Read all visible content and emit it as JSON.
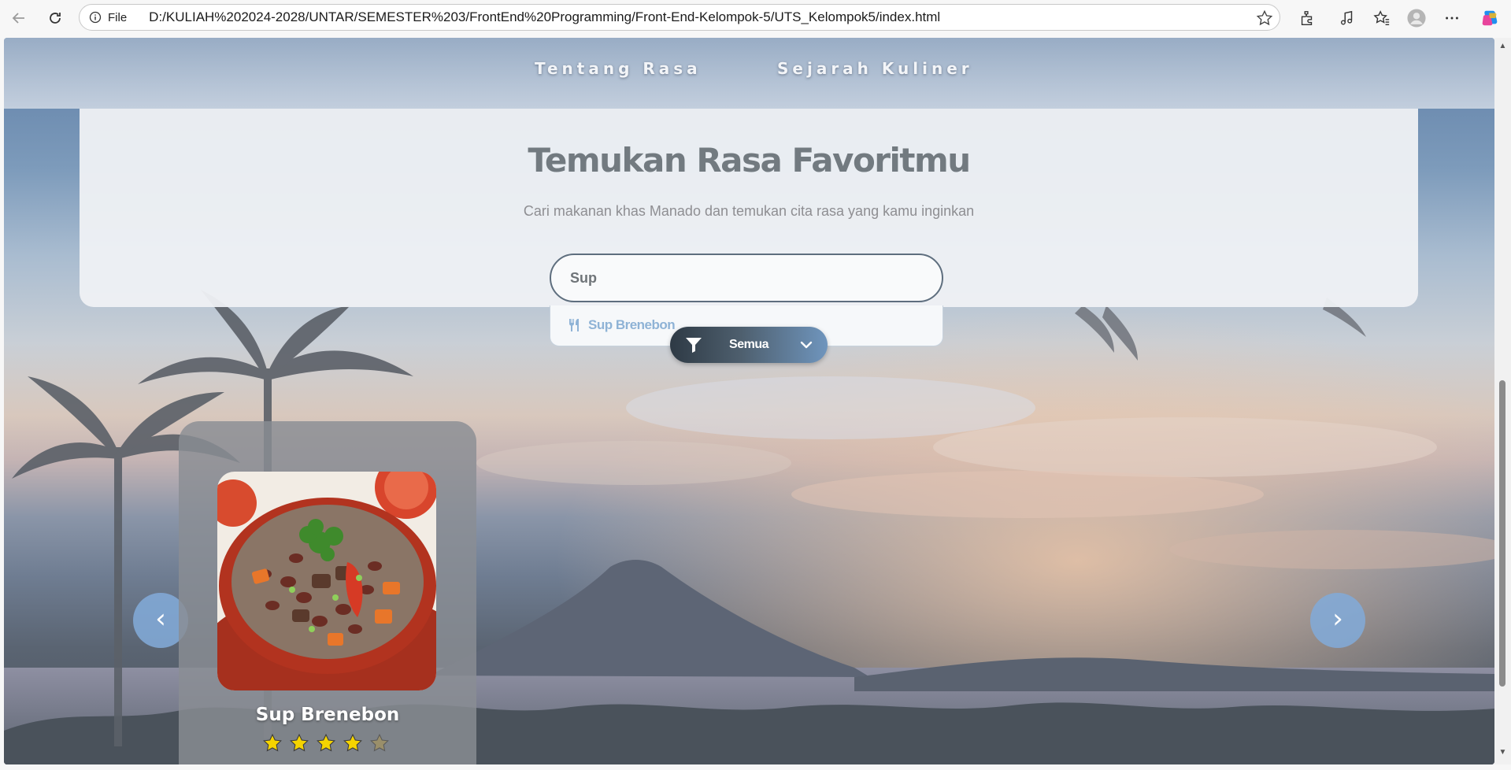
{
  "browser": {
    "file_label": "File",
    "url": "D:/KULIAH%202024-2028/UNTAR/SEMESTER%203/FrontEnd%20Programming/Front-End-Kelompok-5/UTS_Kelompok5/index.html"
  },
  "nav": {
    "links": [
      "Tentang Rasa",
      "Sejarah Kuliner"
    ]
  },
  "search": {
    "title": "Temukan Rasa Favoritmu",
    "subtitle": "Cari makanan khas Manado dan temukan cita rasa yang kamu inginkan",
    "query": "Sup",
    "suggestions": [
      {
        "label": "Sup Brenebon",
        "icon": "fork-knife-icon"
      }
    ]
  },
  "filter": {
    "label": "Semua",
    "icon": "filter-icon"
  },
  "carousel": {
    "prev_label": "‹",
    "next_label": "›",
    "cards": [
      {
        "name": "Sup Brenebon",
        "rating": 4,
        "max_rating": 5
      }
    ]
  },
  "colors": {
    "accent": "#8fb3d6",
    "star_filled": "#f5d400",
    "star_empty": "#9a8f6a"
  }
}
